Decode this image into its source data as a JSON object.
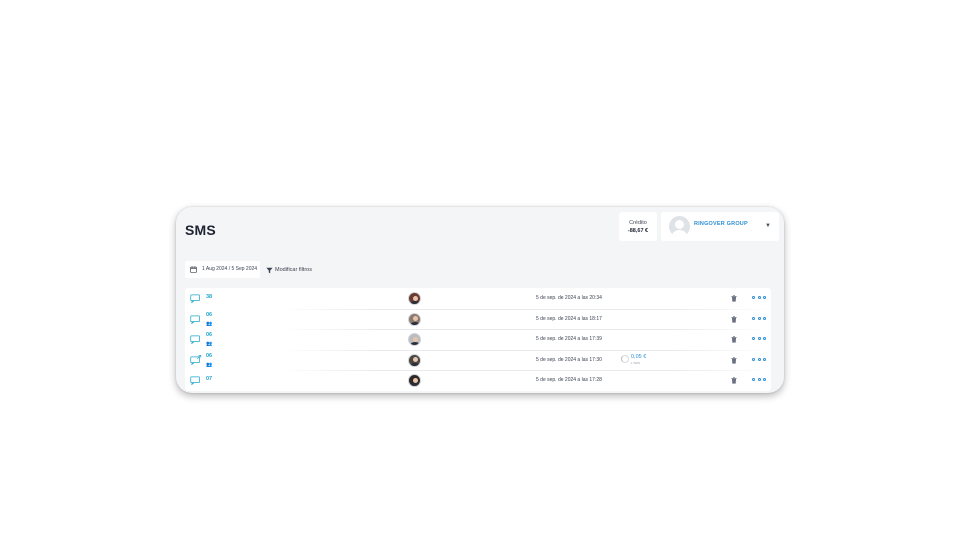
{
  "page": {
    "title": "SMS"
  },
  "credit": {
    "label": "Crédito",
    "value": "-88,67 €"
  },
  "account": {
    "name": "RINGOVER GROUP",
    "avatar_icon": "default-user-avatar-icon",
    "chevron_icon": "chevron-down-icon"
  },
  "filters": {
    "date_range": "1 Aug 2024 / 5 Sep 2024",
    "date_icon": "calendar-icon",
    "modify_label": "Modificar filtros",
    "modify_icon": "funnel-icon"
  },
  "colors": {
    "accent": "#2d8fd5",
    "number": "#1ca6c9",
    "title": "#1d2330"
  },
  "sms_rows": [
    {
      "number": "38",
      "has_people": false,
      "direction": "incoming",
      "datetime": "5 de sep. de 2024 a las 20:34",
      "cost": "",
      "cost_sub": "",
      "avatar_tone": "#6b3a34"
    },
    {
      "number": "06",
      "has_people": true,
      "direction": "incoming",
      "datetime": "5 de sep. de 2024 a las 18:17",
      "cost": "",
      "cost_sub": "",
      "avatar_tone": "#8a7a70"
    },
    {
      "number": "06",
      "has_people": true,
      "direction": "incoming",
      "datetime": "5 de sep. de 2024 a las 17:39",
      "cost": "",
      "cost_sub": "",
      "avatar_tone": "#b9bcc0"
    },
    {
      "number": "06",
      "has_people": true,
      "direction": "outgoing",
      "datetime": "5 de sep. de 2024 a las 17:30",
      "cost": "0,05 €",
      "cost_sub": "1 SMS",
      "avatar_tone": "#4a4640"
    },
    {
      "number": "07",
      "has_people": false,
      "direction": "incoming",
      "datetime": "5 de sep. de 2024 a las 17:28",
      "cost": "",
      "cost_sub": "",
      "avatar_tone": "#2e2a28"
    }
  ],
  "row_actions": {
    "delete_icon": "trash-icon",
    "more_icon": "more-options-icon"
  }
}
